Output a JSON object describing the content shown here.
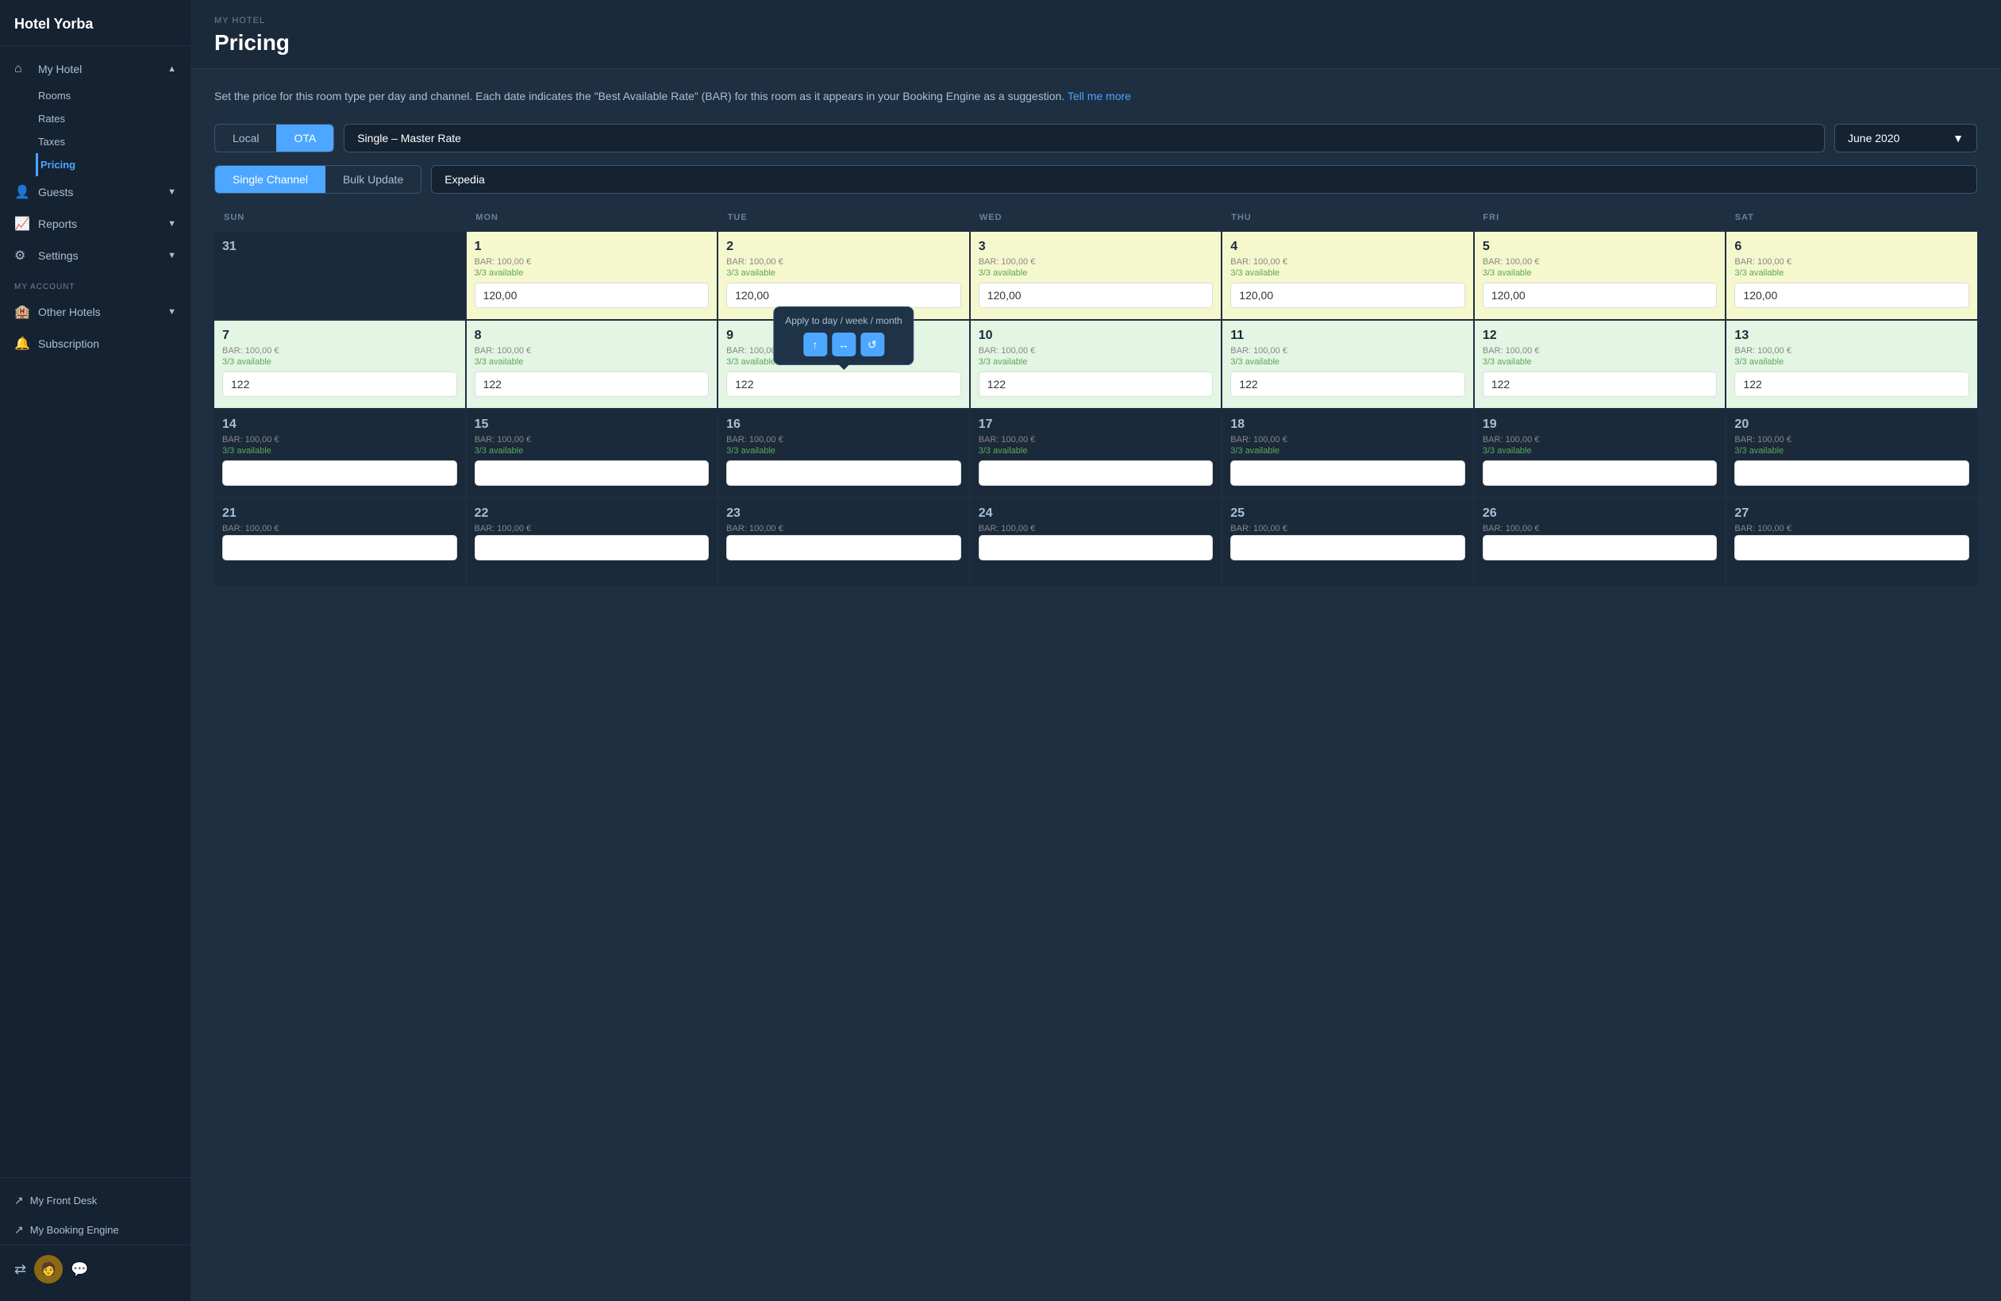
{
  "sidebar": {
    "hotel_name": "Hotel Yorba",
    "nav": {
      "my_hotel_label": "My Hotel",
      "rooms_label": "Rooms",
      "rates_label": "Rates",
      "taxes_label": "Taxes",
      "pricing_label": "Pricing",
      "guests_label": "Guests",
      "reports_label": "Reports",
      "settings_label": "Settings",
      "my_account_label": "MY ACCOUNT",
      "other_hotels_label": "Other Hotels",
      "subscription_label": "Subscription"
    },
    "footer": {
      "front_desk_label": "My Front Desk",
      "booking_engine_label": "My Booking Engine"
    }
  },
  "header": {
    "breadcrumb": "MY HOTEL",
    "title": "Pricing"
  },
  "description": {
    "text": "Set the price for this room type per day and channel. Each date indicates the \"Best Available Rate\" (BAR) for this room as it appears in your Booking Engine as a suggestion.",
    "link_text": "Tell me more"
  },
  "controls": {
    "tab_local": "Local",
    "tab_ota": "OTA",
    "rate_select": "Single – Master Rate",
    "date_select": "June 2020",
    "tab_single_channel": "Single Channel",
    "tab_bulk_update": "Bulk Update",
    "channel_select": "Expedia"
  },
  "calendar": {
    "headers": [
      "SUN",
      "MON",
      "TUE",
      "WED",
      "THU",
      "FRI",
      "SAT"
    ],
    "rows": [
      [
        {
          "day": "31",
          "bar": "",
          "avail": "",
          "value": "",
          "type": "inactive"
        },
        {
          "day": "1",
          "bar": "BAR: 100,00 €",
          "avail": "3/3 available",
          "value": "120,00",
          "type": "highlight"
        },
        {
          "day": "2",
          "bar": "BAR: 100,00 €",
          "avail": "3/3 available",
          "value": "120,00",
          "type": "highlight"
        },
        {
          "day": "3",
          "bar": "BAR: 100,00 €",
          "avail": "3/3 available",
          "value": "120,00",
          "type": "highlight"
        },
        {
          "day": "4",
          "bar": "BAR: 100,00 €",
          "avail": "3/3 available",
          "value": "120,00",
          "type": "highlight"
        },
        {
          "day": "5",
          "bar": "BAR: 100,00 €",
          "avail": "3/3 available",
          "value": "120,00",
          "type": "highlight"
        },
        {
          "day": "6",
          "bar": "BAR: 100,00 €",
          "avail": "3/3 available",
          "value": "120,00",
          "type": "highlight"
        }
      ],
      [
        {
          "day": "7",
          "bar": "BAR: 100,00 €",
          "avail": "3/3 available",
          "value": "122",
          "type": "green"
        },
        {
          "day": "8",
          "bar": "BAR: 100,00 €",
          "avail": "3/3 available",
          "value": "122",
          "type": "green"
        },
        {
          "day": "9",
          "bar": "BAR: 100,00 €",
          "avail": "3/3 available",
          "value": "122",
          "type": "green",
          "tooltip": true
        },
        {
          "day": "10",
          "bar": "BAR: 100,00 €",
          "avail": "3/3 available",
          "value": "122",
          "type": "green"
        },
        {
          "day": "11",
          "bar": "BAR: 100,00 €",
          "avail": "3/3 available",
          "value": "122",
          "type": "green"
        },
        {
          "day": "12",
          "bar": "BAR: 100,00 €",
          "avail": "3/3 available",
          "value": "122",
          "type": "green"
        },
        {
          "day": "13",
          "bar": "BAR: 100,00 €",
          "avail": "3/3 available",
          "value": "122",
          "type": "green"
        }
      ],
      [
        {
          "day": "14",
          "bar": "BAR: 100,00 €",
          "avail": "3/3 available",
          "value": "",
          "type": "dark"
        },
        {
          "day": "15",
          "bar": "BAR: 100,00 €",
          "avail": "3/3 available",
          "value": "",
          "type": "dark"
        },
        {
          "day": "16",
          "bar": "BAR: 100,00 €",
          "avail": "3/3 available",
          "value": "",
          "type": "dark"
        },
        {
          "day": "17",
          "bar": "BAR: 100,00 €",
          "avail": "3/3 available",
          "value": "",
          "type": "dark"
        },
        {
          "day": "18",
          "bar": "BAR: 100,00 €",
          "avail": "3/3 available",
          "value": "",
          "type": "dark"
        },
        {
          "day": "19",
          "bar": "BAR: 100,00 €",
          "avail": "3/3 available",
          "value": "",
          "type": "dark"
        },
        {
          "day": "20",
          "bar": "BAR: 100,00 €",
          "avail": "3/3 available",
          "value": "",
          "type": "dark"
        }
      ],
      [
        {
          "day": "21",
          "bar": "BAR: 100,00 €",
          "avail": "",
          "value": "",
          "type": "dark"
        },
        {
          "day": "22",
          "bar": "BAR: 100,00 €",
          "avail": "",
          "value": "",
          "type": "dark"
        },
        {
          "day": "23",
          "bar": "BAR: 100,00 €",
          "avail": "",
          "value": "",
          "type": "dark"
        },
        {
          "day": "24",
          "bar": "BAR: 100,00 €",
          "avail": "",
          "value": "",
          "type": "dark"
        },
        {
          "day": "25",
          "bar": "BAR: 100,00 €",
          "avail": "",
          "value": "",
          "type": "dark"
        },
        {
          "day": "26",
          "bar": "BAR: 100,00 €",
          "avail": "",
          "value": "",
          "type": "dark"
        },
        {
          "day": "27",
          "bar": "BAR: 100,00 €",
          "avail": "",
          "value": "",
          "type": "dark"
        }
      ]
    ]
  },
  "tooltip": {
    "title": "Apply to day / week / month",
    "btn_up": "↑",
    "btn_lr": "↔",
    "btn_refresh": "↺"
  },
  "colors": {
    "highlight_bg": "#f9fac5",
    "green_bg": "#e3f5e3",
    "dark_bg": "#1a2a3a",
    "accent": "#4da6ff",
    "sidebar_bg": "#152232"
  }
}
